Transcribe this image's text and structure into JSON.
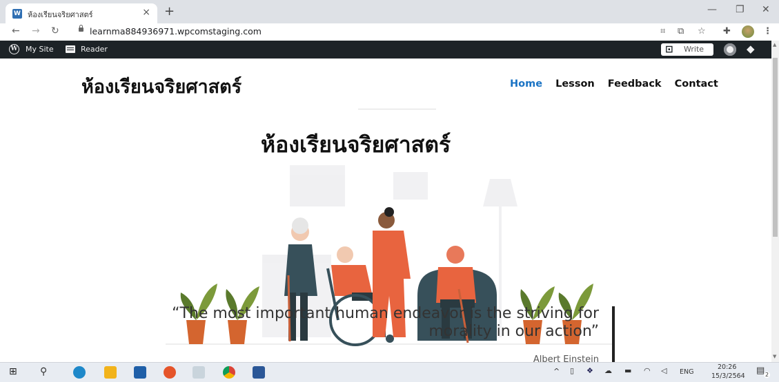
{
  "browser": {
    "tab_title": "ห้องเรียนจริยศาสตร์",
    "tab_close": "×",
    "new_tab": "+",
    "url": "learnma884936971.wpcomstaging.com",
    "window_min": "—",
    "window_restore": "❐",
    "window_close": "✕"
  },
  "wp_admin_bar": {
    "my_site": "My Site",
    "reader": "Reader",
    "write": "Write"
  },
  "site": {
    "title": "ห้องเรียนจริยศาสตร์",
    "menu": [
      {
        "label": "Home",
        "active": true
      },
      {
        "label": "Lesson",
        "active": false
      },
      {
        "label": "Feedback",
        "active": false
      },
      {
        "label": "Contact",
        "active": false
      }
    ],
    "hero_heading": "ห้องเรียนจริยศาสตร์",
    "quote": "“The most important human endeavor is the striving for morality in our action”",
    "quote_line1": "“The most important human endeavor is the striving for",
    "quote_line2": "morality in our action”",
    "quote_author": "Albert Einstein"
  },
  "taskbar": {
    "language": "ENG",
    "time": "20:26",
    "date": "15/3/2564",
    "notification_count": "2"
  },
  "colors": {
    "menu_active": "#1a73c4",
    "wp_bar": "#1d2327",
    "illustration_orange": "#e8643f",
    "illustration_teal": "#37505a"
  }
}
